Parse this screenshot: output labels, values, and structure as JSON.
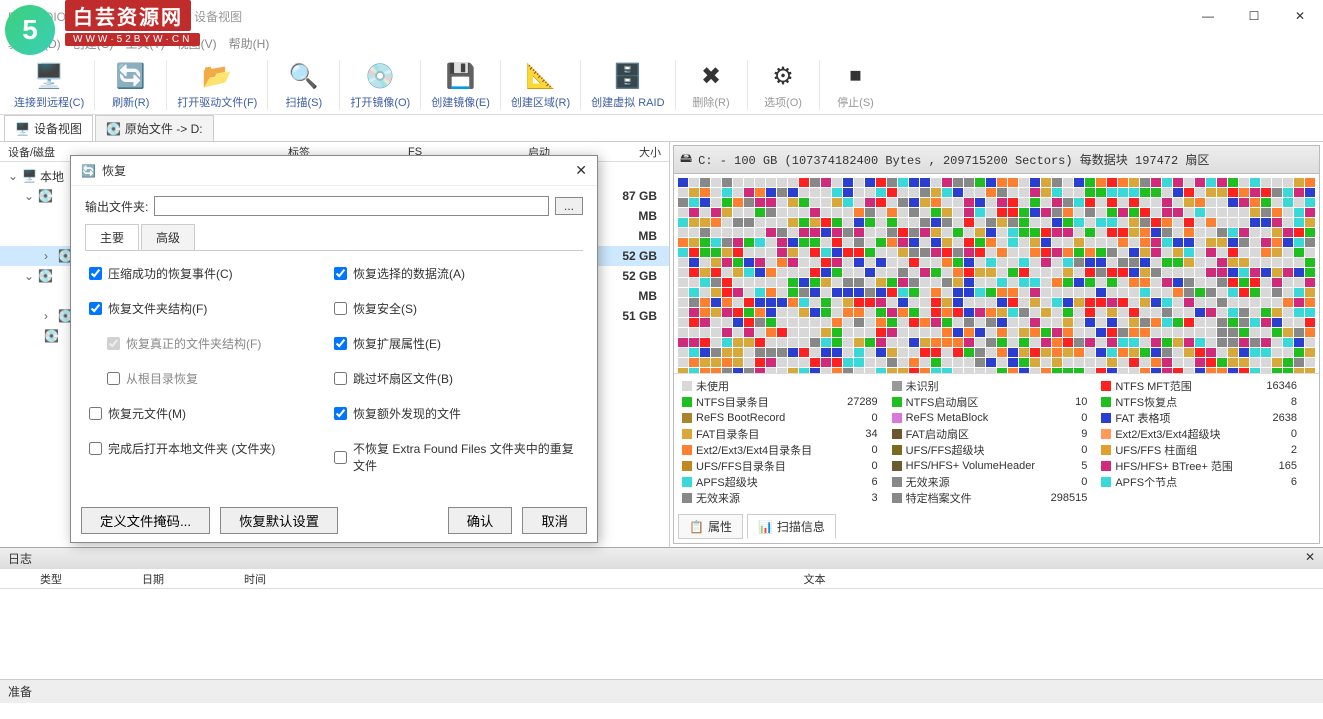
{
  "window": {
    "title": "R-STUDIO Network 8.13.176037 - 设备视图",
    "watermark_brand": "白芸资源网",
    "watermark_url": "WWW·52BYW·CN"
  },
  "menubar": [
    "驱动器(D)",
    "创建(C)",
    "工具(T)",
    "视图(V)",
    "帮助(H)"
  ],
  "toolbar": [
    {
      "label": "连接到远程(C)",
      "icon": "🖥️"
    },
    {
      "label": "刷新(R)",
      "icon": "🔄"
    },
    {
      "label": "打开驱动文件(F)",
      "icon": "📂"
    },
    {
      "label": "扫描(S)",
      "icon": "🔍"
    },
    {
      "label": "打开镜像(O)",
      "icon": "💿"
    },
    {
      "label": "创建镜像(E)",
      "icon": "💾"
    },
    {
      "label": "创建区域(R)",
      "icon": "📐"
    },
    {
      "label": "创建虚拟 RAID",
      "icon": "🗄️"
    },
    {
      "label": "删除(R)",
      "icon": "✖",
      "grey": true
    },
    {
      "label": "选项(O)",
      "icon": "⚙",
      "grey": true
    },
    {
      "label": "停止(S)",
      "icon": "⏹",
      "grey": true
    }
  ],
  "tabs": {
    "device_view": "设备视图",
    "raw_files": "原始文件 -> D:"
  },
  "columns": {
    "drive": "设备/磁盘",
    "label": "标签",
    "fs": "FS",
    "start": "启动",
    "size": "大小"
  },
  "tree": {
    "root": "本地",
    "sizes": [
      "87 GB",
      "MB",
      "MB",
      "52 GB",
      "52 GB",
      "MB",
      "51 GB"
    ]
  },
  "right_header": "C: - 100 GB (107374182400 Bytes , 209715200 Sectors) 每数据块 197472 扇区",
  "legend": [
    [
      {
        "c": "#d8d8d8",
        "l": "未使用",
        "v": ""
      },
      {
        "c": "#999",
        "l": "未识别",
        "v": ""
      },
      {
        "c": "#ff2020",
        "l": "NTFS MFT范围",
        "v": "16346"
      }
    ],
    [
      {
        "c": "#1fbf1f",
        "l": "NTFS目录条目",
        "v": "27289"
      },
      {
        "c": "#1fbf1f",
        "l": "NTFS启动扇区",
        "v": "10"
      },
      {
        "c": "#1fbf1f",
        "l": "NTFS恢复点",
        "v": "8"
      }
    ],
    [
      {
        "c": "#a8852a",
        "l": "ReFS BootRecord",
        "v": "0"
      },
      {
        "c": "#d978d9",
        "l": "ReFS MetaBlock",
        "v": "0"
      },
      {
        "c": "#2a3fd1",
        "l": "FAT 表格项",
        "v": "2638"
      }
    ],
    [
      {
        "c": "#d9a83a",
        "l": "FAT目录条目",
        "v": "34"
      },
      {
        "c": "#6b5830",
        "l": "FAT启动扇区",
        "v": "9"
      },
      {
        "c": "#ff9a5a",
        "l": "Ext2/Ext3/Ext4超级块",
        "v": "0"
      }
    ],
    [
      {
        "c": "#ff7f30",
        "l": "Ext2/Ext3/Ext4目录条目",
        "v": "0"
      },
      {
        "c": "#7a6a1f",
        "l": "UFS/FFS超级块",
        "v": "0"
      },
      {
        "c": "#e0a030",
        "l": "UFS/FFS 柱面组",
        "v": "2"
      }
    ],
    [
      {
        "c": "#c08820",
        "l": "UFS/FFS目录条目",
        "v": "0"
      },
      {
        "c": "#6a5c30",
        "l": "HFS/HFS+ VolumeHeader",
        "v": "5"
      },
      {
        "c": "#d12a7a",
        "l": "HFS/HFS+ BTree+ 范围",
        "v": "165"
      }
    ],
    [
      {
        "c": "#3ad9d9",
        "l": "APFS超级块",
        "v": "6"
      },
      {
        "c": "#888",
        "l": "无效来源",
        "v": "0"
      },
      {
        "c": "#3ad9d9",
        "l": "APFS个节点",
        "v": "6"
      }
    ],
    [
      {
        "c": "#888",
        "l": "无效来源",
        "v": "3"
      },
      {
        "c": "#888",
        "l": "特定档案文件",
        "v": "298515"
      },
      {
        "c": "",
        "l": "",
        "v": ""
      }
    ]
  ],
  "right_tabs": {
    "props": "属性",
    "scan_info": "扫描信息"
  },
  "log": {
    "title": "日志",
    "cols": [
      "类型",
      "日期",
      "时间",
      "文本"
    ]
  },
  "status": "准备",
  "dialog": {
    "title": "恢复",
    "output_label": "输出文件夹:",
    "browse": "...",
    "tabs": {
      "main": "主要",
      "adv": "高级"
    },
    "left_opts": [
      {
        "l": "压缩成功的恢复事件(C)",
        "ck": true
      },
      {
        "l": "恢复文件夹结构(F)",
        "ck": true
      },
      {
        "l": "恢复真正的文件夹结构(F)",
        "ck": true,
        "indent": true,
        "dis": true
      },
      {
        "l": "从根目录恢复",
        "ck": false,
        "indent": true
      },
      {
        "l": "恢复元文件(M)",
        "ck": false
      },
      {
        "l": "完成后打开本地文件夹 (文件夹)",
        "ck": false
      }
    ],
    "right_opts": [
      {
        "l": "恢复选择的数据流(A)",
        "ck": true
      },
      {
        "l": "恢复安全(S)",
        "ck": false
      },
      {
        "l": "恢复扩展属性(E)",
        "ck": true
      },
      {
        "l": "跳过坏扇区文件(B)",
        "ck": false
      },
      {
        "l": "恢复额外发现的文件",
        "ck": true
      },
      {
        "l": "不恢复 Extra Found Files 文件夹中的重复文件",
        "ck": false
      }
    ],
    "btn_mask": "定义文件掩码...",
    "btn_reset": "恢复默认设置",
    "btn_ok": "确认",
    "btn_cancel": "取消"
  }
}
